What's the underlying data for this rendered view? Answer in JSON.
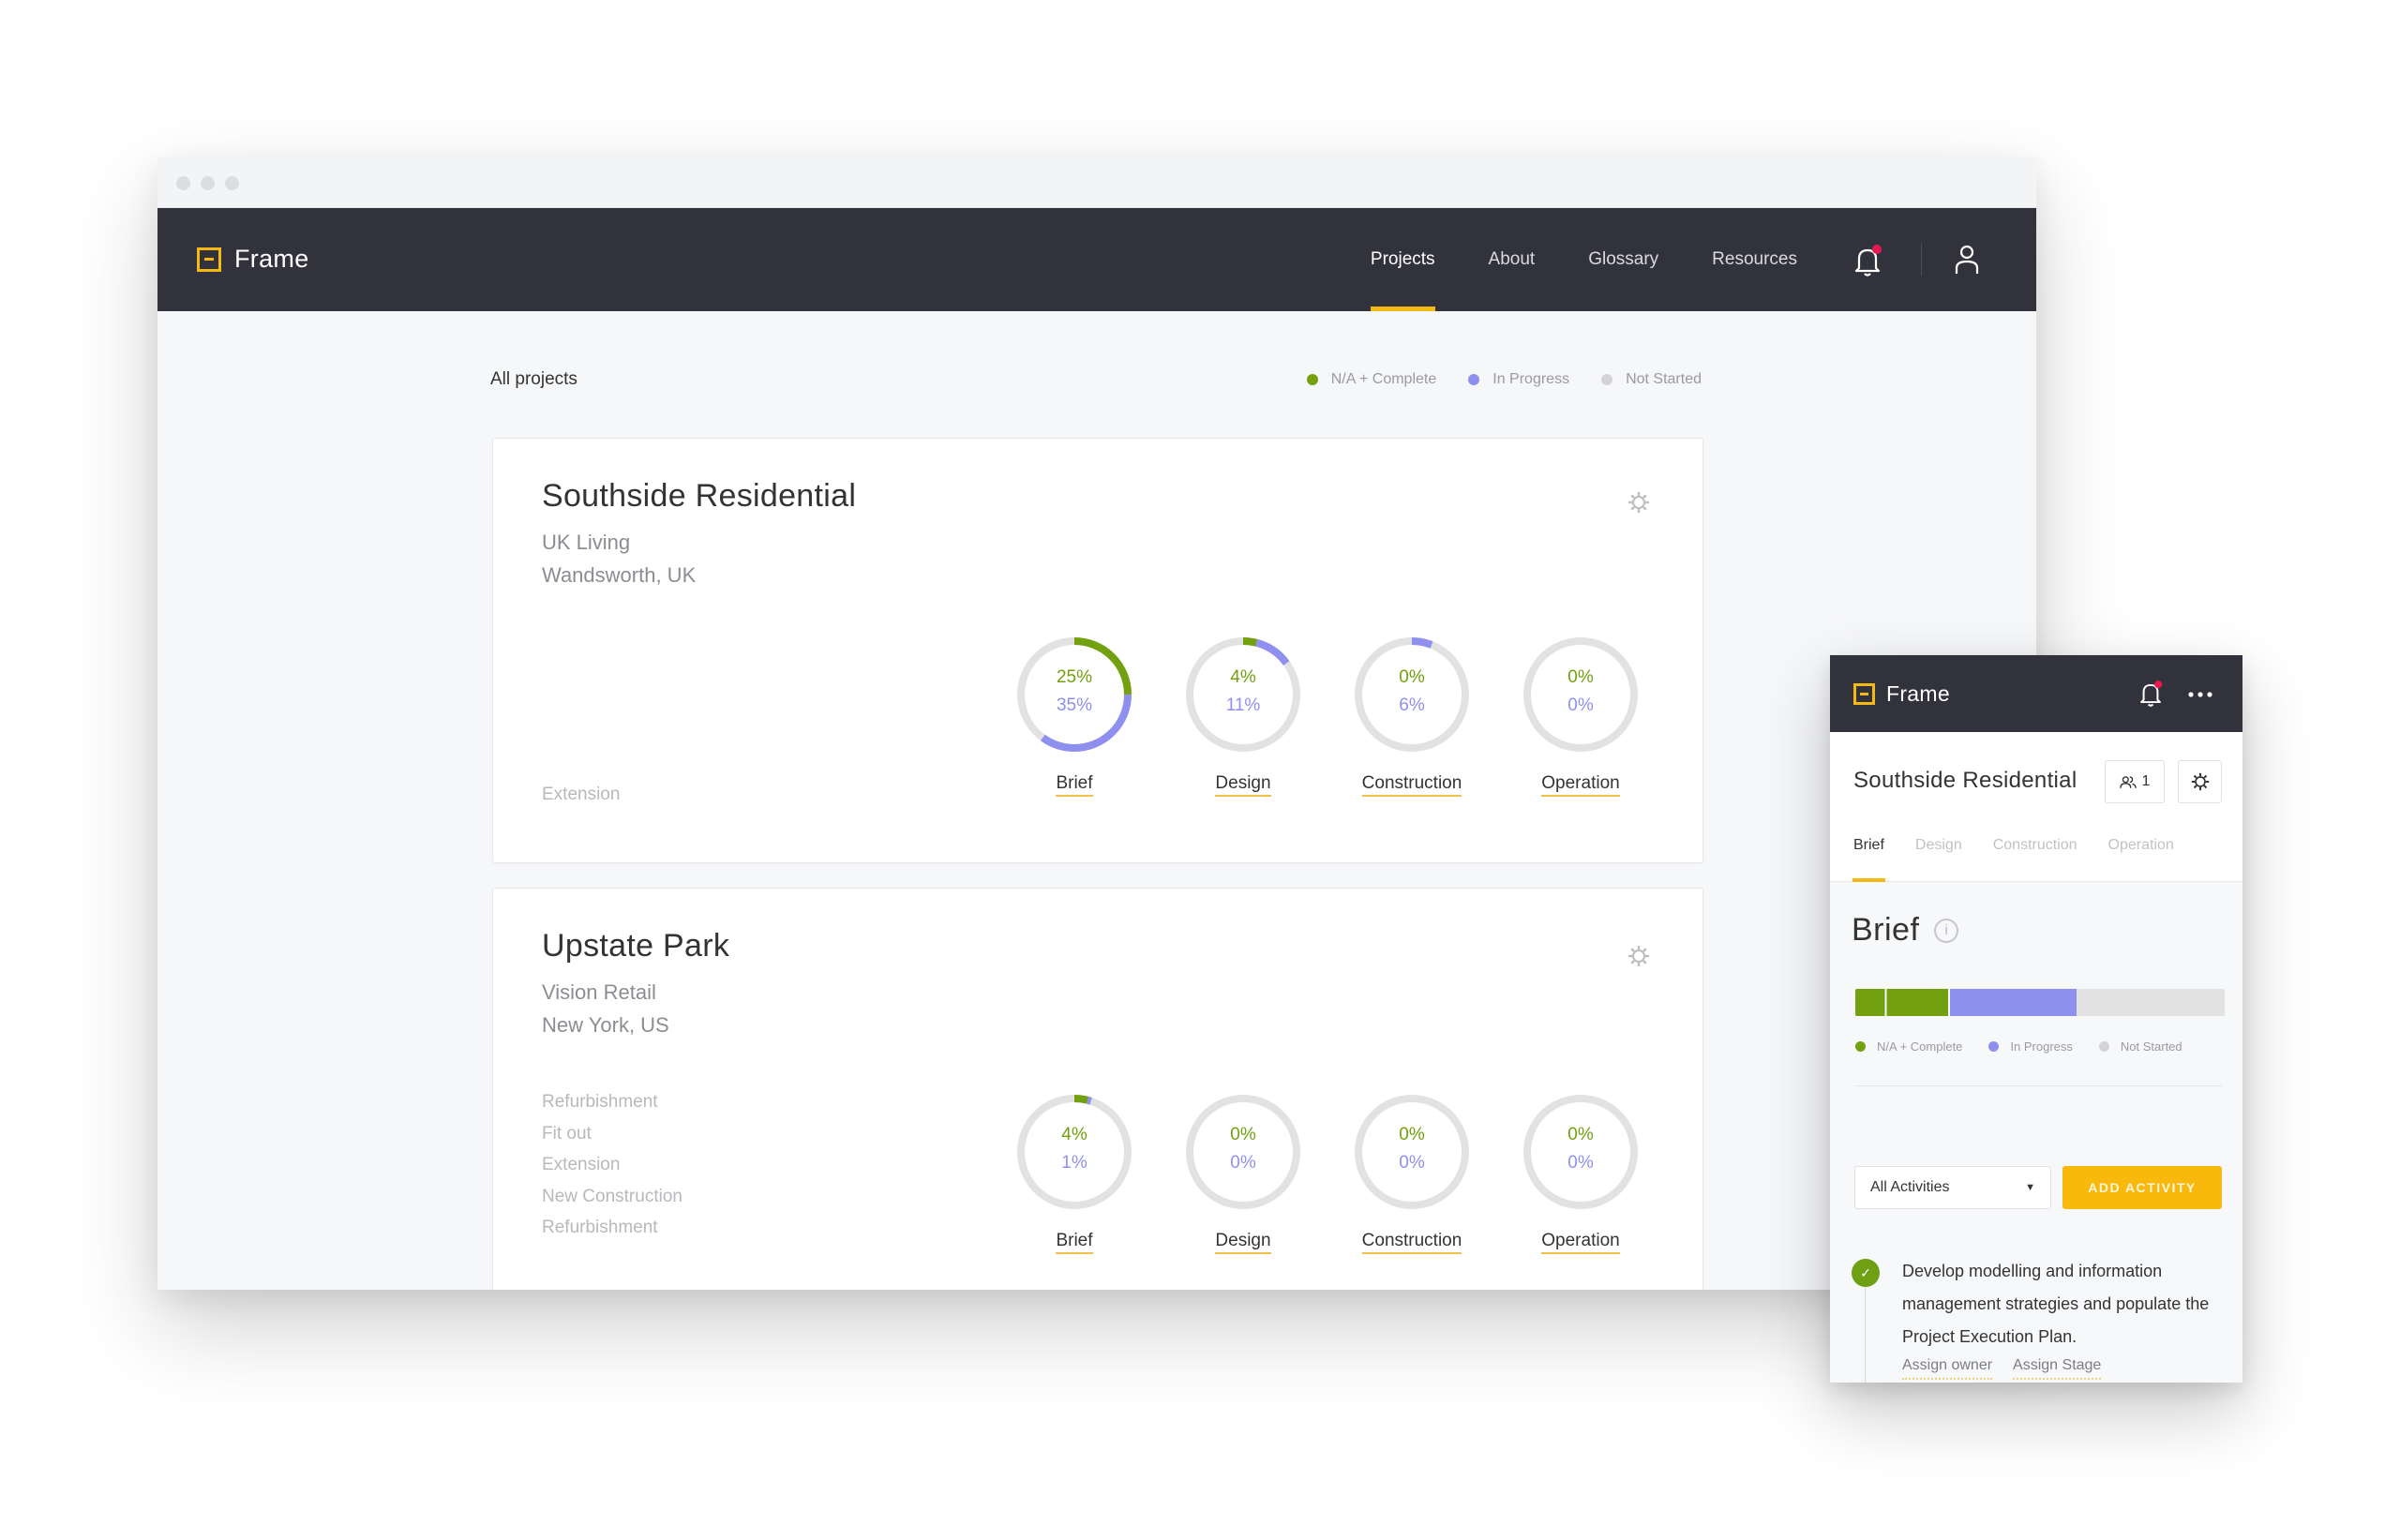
{
  "colors": {
    "accent": "#f5b914",
    "complete": "#72a00e",
    "in_progress": "#8f8ff0",
    "not_started": "#e2e2e2",
    "navbar": "#32323c",
    "notification_dot": "#e8174f"
  },
  "app": {
    "logo_text": "Frame",
    "nav": [
      {
        "label": "Projects",
        "active": true
      },
      {
        "label": "About",
        "active": false
      },
      {
        "label": "Glossary",
        "active": false
      },
      {
        "label": "Resources",
        "active": false
      }
    ],
    "icons": {
      "notifications": "bell-icon",
      "account": "user-icon",
      "settings": "gear-icon"
    }
  },
  "page": {
    "title": "All projects",
    "legend": [
      {
        "label": "N/A + Complete",
        "color": "#72a00e"
      },
      {
        "label": "In Progress",
        "color": "#8f8ff0"
      },
      {
        "label": "Not Started",
        "color": "#d4d4d6"
      }
    ]
  },
  "projects": [
    {
      "name": "Southside Residential",
      "client": "UK Living",
      "location": "Wandsworth, UK",
      "types": [
        "Extension"
      ],
      "stages": [
        {
          "name": "Brief",
          "complete": 25,
          "in_progress": 35,
          "complete_label": "25%",
          "in_progress_label": "35%"
        },
        {
          "name": "Design",
          "complete": 4,
          "in_progress": 11,
          "complete_label": "4%",
          "in_progress_label": "11%"
        },
        {
          "name": "Construction",
          "complete": 0,
          "in_progress": 6,
          "complete_label": "0%",
          "in_progress_label": "6%"
        },
        {
          "name": "Operation",
          "complete": 0,
          "in_progress": 0,
          "complete_label": "0%",
          "in_progress_label": "0%"
        }
      ]
    },
    {
      "name": "Upstate Park",
      "client": "Vision Retail",
      "location": "New York, US",
      "types": [
        "Refurbishment",
        "Fit out",
        "Extension",
        "New Construction",
        "Refurbishment"
      ],
      "stages": [
        {
          "name": "Brief",
          "complete": 4,
          "in_progress": 1,
          "complete_label": "4%",
          "in_progress_label": "1%"
        },
        {
          "name": "Design",
          "complete": 0,
          "in_progress": 0,
          "complete_label": "0%",
          "in_progress_label": "0%"
        },
        {
          "name": "Construction",
          "complete": 0,
          "in_progress": 0,
          "complete_label": "0%",
          "in_progress_label": "0%"
        },
        {
          "name": "Operation",
          "complete": 0,
          "in_progress": 0,
          "complete_label": "0%",
          "in_progress_label": "0%"
        }
      ]
    }
  ],
  "mobile": {
    "logo_text": "Frame",
    "project_title": "Southside Residential",
    "members_count": "1",
    "tabs": [
      {
        "label": "Brief",
        "active": true
      },
      {
        "label": "Design",
        "active": false
      },
      {
        "label": "Construction",
        "active": false
      },
      {
        "label": "Operation",
        "active": false
      }
    ],
    "stage_title": "Brief",
    "info_glyph": "i",
    "progress": {
      "complete": 25,
      "in_progress": 35,
      "not_started": 40
    },
    "legend": [
      {
        "label": "N/A + Complete",
        "color": "#72a00e"
      },
      {
        "label": "In Progress",
        "color": "#8f8ff0"
      },
      {
        "label": "Not Started",
        "color": "#d4d4d6"
      }
    ],
    "filter": {
      "selected": "All Activities",
      "caret": "▼"
    },
    "add_button": "ADD ACTIVITY",
    "activity": {
      "status": "complete",
      "check_glyph": "✓",
      "text": "Develop modelling and information management strategies and populate the Project Execution Plan.",
      "links": [
        "Assign owner",
        "Assign Stage"
      ]
    }
  }
}
